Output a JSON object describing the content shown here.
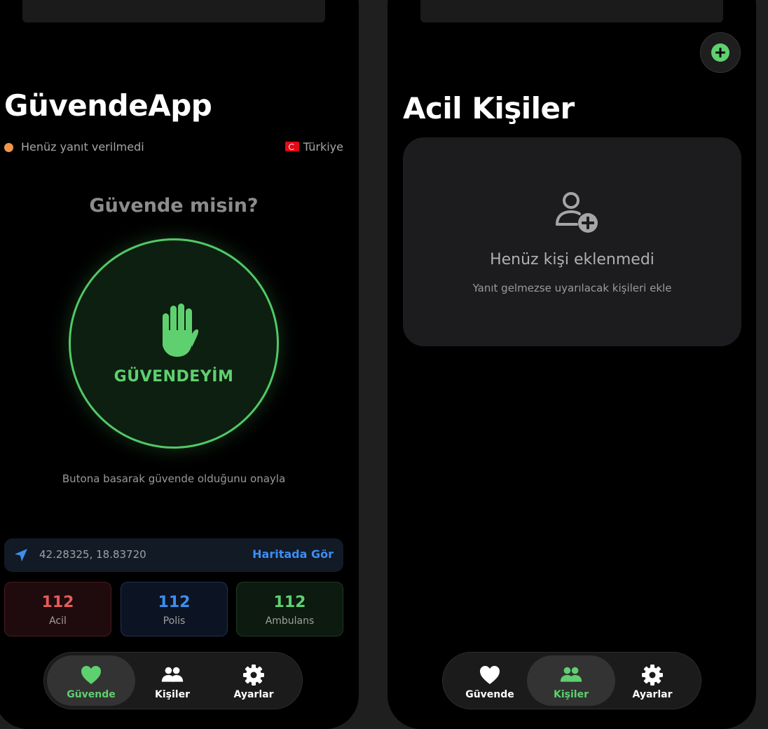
{
  "home": {
    "title": "GüvendeApp",
    "status": "Henüz yanıt verilmedi",
    "country": "Türkiye",
    "question": "Güvende misin?",
    "safe_button": "GÜVENDEYİM",
    "hint": "Butona basarak güvende olduğunu onayla",
    "location": {
      "coords": "42.28325, 18.83720",
      "map_link": "Haritada Gör"
    },
    "emergency": [
      {
        "number": "112",
        "label": "Acil"
      },
      {
        "number": "112",
        "label": "Polis"
      },
      {
        "number": "112",
        "label": "Ambulans"
      }
    ]
  },
  "contacts": {
    "title": "Acil Kişiler",
    "empty_title": "Henüz kişi eklenmedi",
    "empty_subtitle": "Yanıt gelmezse uyarılacak kişileri ekle"
  },
  "tabs": [
    {
      "label": "Güvende",
      "icon": "heart-icon"
    },
    {
      "label": "Kişiler",
      "icon": "people-icon"
    },
    {
      "label": "Ayarlar",
      "icon": "gear-icon"
    }
  ],
  "active_tab_home": "Güvende",
  "active_tab_contacts": "Kişiler",
  "colors": {
    "accent_green": "#5fd06f",
    "status_orange": "#f0954a",
    "link_blue": "#3d8ef0",
    "acil_red": "#e55a5a"
  }
}
